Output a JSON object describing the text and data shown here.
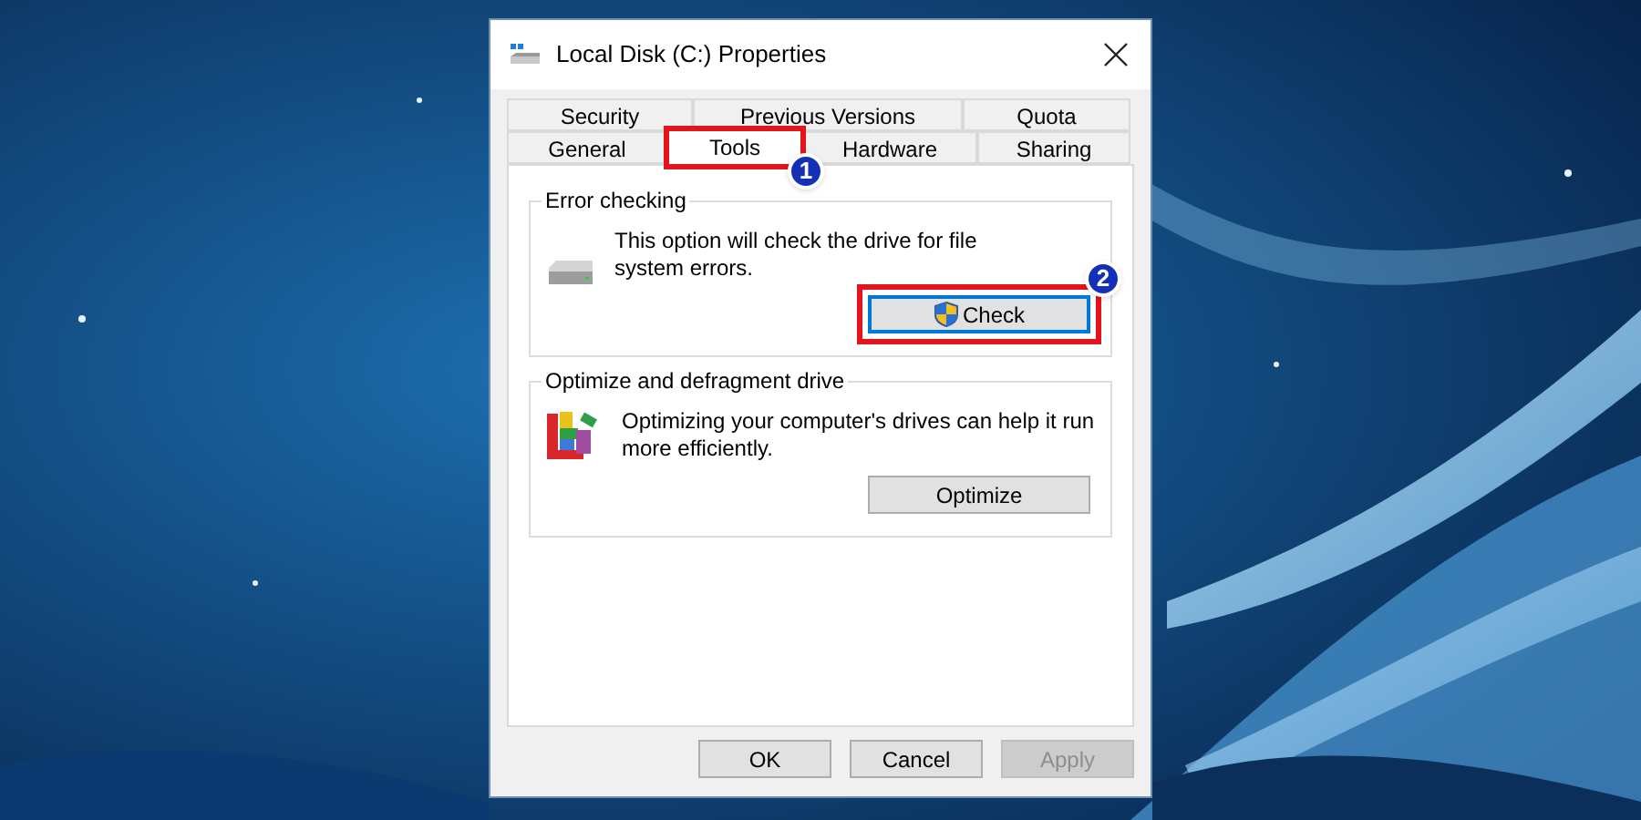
{
  "window": {
    "title": "Local Disk (C:) Properties"
  },
  "tab_rows": [
    [
      {
        "label": "Security",
        "selected": false
      },
      {
        "label": "Previous Versions",
        "selected": false
      },
      {
        "label": "Quota",
        "selected": false
      }
    ],
    [
      {
        "label": "General",
        "selected": false
      },
      {
        "label": "Tools",
        "selected": true,
        "highlighted": true,
        "badge": "1"
      },
      {
        "label": "Hardware",
        "selected": false
      },
      {
        "label": "Sharing",
        "selected": false
      }
    ]
  ],
  "groups": [
    {
      "kind": "check",
      "title": "Error checking",
      "text": "This option will check the drive for file system errors.",
      "button": {
        "label": "Check",
        "default": true,
        "highlighted": true,
        "badge": "2"
      }
    },
    {
      "kind": "optimize",
      "title": "Optimize and defragment drive",
      "text": "Optimizing your computer's drives can help it run more efficiently.",
      "button": {
        "label": "Optimize",
        "default": false,
        "highlighted": false
      }
    }
  ],
  "buttons": [
    {
      "label": "OK",
      "disabled": false
    },
    {
      "label": "Cancel",
      "disabled": false
    },
    {
      "label": "Apply",
      "disabled": true
    }
  ]
}
